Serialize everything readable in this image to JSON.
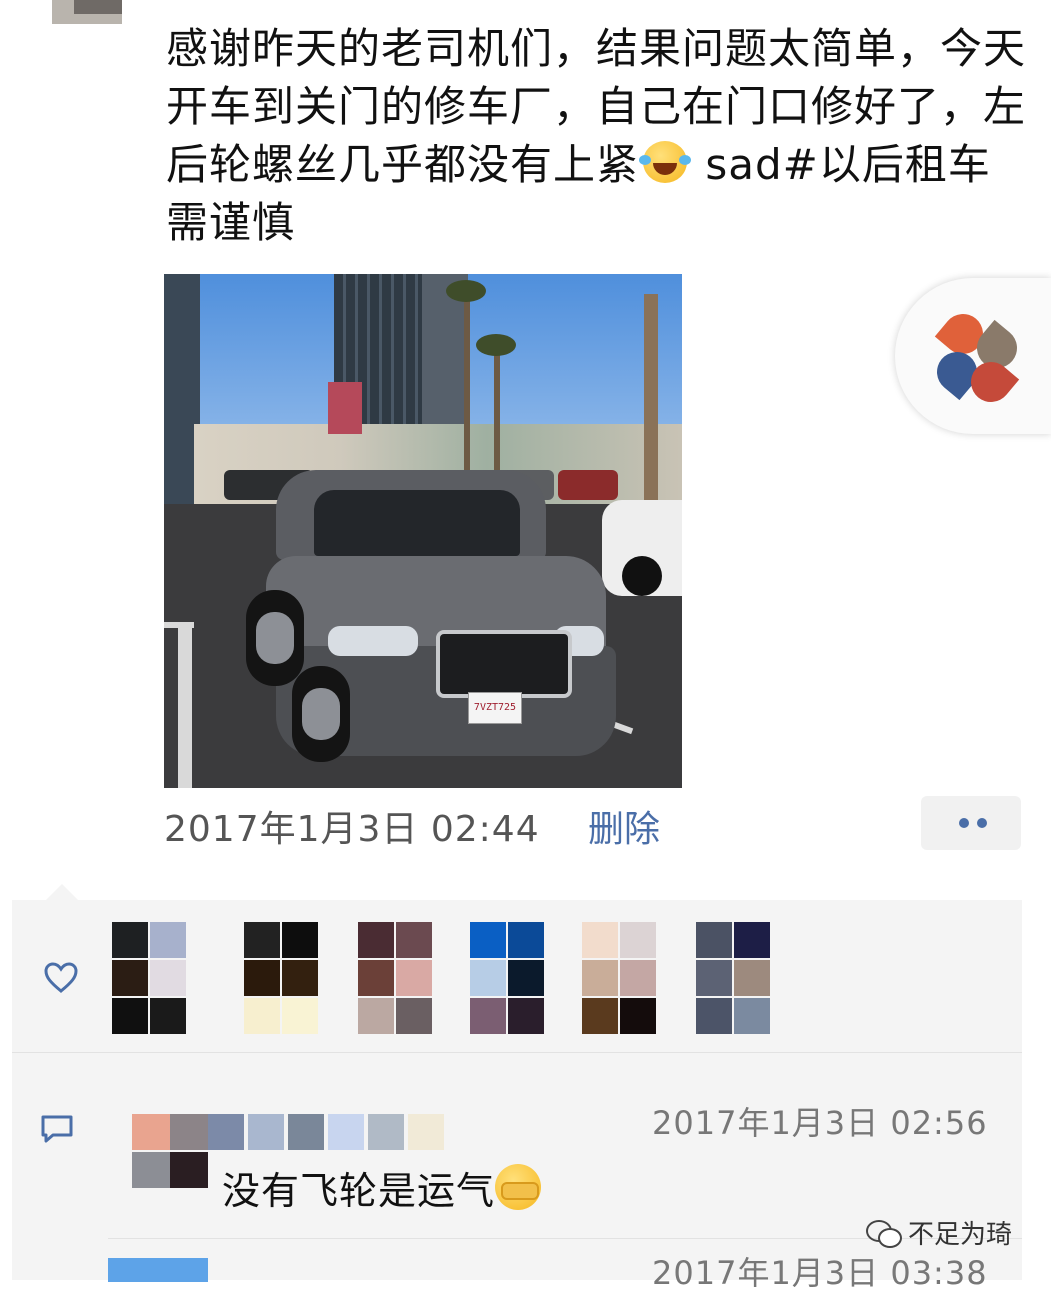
{
  "post": {
    "text": "感谢昨天的老司机们，结果问题太简单，今天开车到关门的修车厂，自己在门口修好了，左后轮螺丝几乎都没有上紧",
    "text_tail": " sad#以后租车需谨慎",
    "emoji": "laughing-tears-emoji",
    "photo_alt": "Gray Nissan SUV parked in a lot",
    "plate": "7VZT725",
    "timestamp": "2017年1月3日  02:44",
    "delete_label": "删除"
  },
  "likes": {
    "icon": "heart-icon",
    "avatars": [
      {
        "colors": [
          "#1e2022",
          "#a7b1cc",
          "#2b1d14",
          "#e1dbe2",
          "#101010",
          "#1a1a1a"
        ]
      },
      {
        "colors": [
          "#222222",
          "#0d0d0d",
          "#2b1a0c",
          "#33200f",
          "#f7efcf",
          "#f9f3d4"
        ]
      },
      {
        "colors": [
          "#4a2c33",
          "#6b4a50",
          "#6b4038",
          "#d9a9a4",
          "#bba8a2",
          "#6a5f62"
        ]
      },
      {
        "colors": [
          "#0a5fc4",
          "#0b4a98",
          "#b7cde6",
          "#0b1a2c",
          "#7b5e72",
          "#2a1e2c"
        ]
      },
      {
        "colors": [
          "#f2dccc",
          "#dcd3d4",
          "#c9ad99",
          "#c4a7a4",
          "#5a3a1e",
          "#140c0c"
        ]
      },
      {
        "colors": [
          "#4b5264",
          "#1d1e46",
          "#5c6274",
          "#9d8a7e",
          "#4c5468",
          "#7b8aa0"
        ]
      }
    ]
  },
  "comments": [
    {
      "avatar_colors": [
        "#e9a48f",
        "#8c8488",
        "#8c8e95",
        "#2a1e22"
      ],
      "name_colors": [
        "#7c8aa8",
        "#a9b7cf",
        "#7a8799",
        "#c8d5ef",
        "#b0bac6",
        "#f1ead7"
      ],
      "time": "2017年1月3日  02:56",
      "text": "没有飞轮是运气",
      "emoji": "facepalm-emoji"
    },
    {
      "time": "2017年1月3日  03:38"
    }
  ],
  "watermark": "不足为琦",
  "colors": {
    "link": "#4a6ea8",
    "panel": "#f4f4f4",
    "logo": [
      "#e0613a",
      "#3a5a92",
      "#8a7a6a",
      "#c54a3a"
    ]
  }
}
